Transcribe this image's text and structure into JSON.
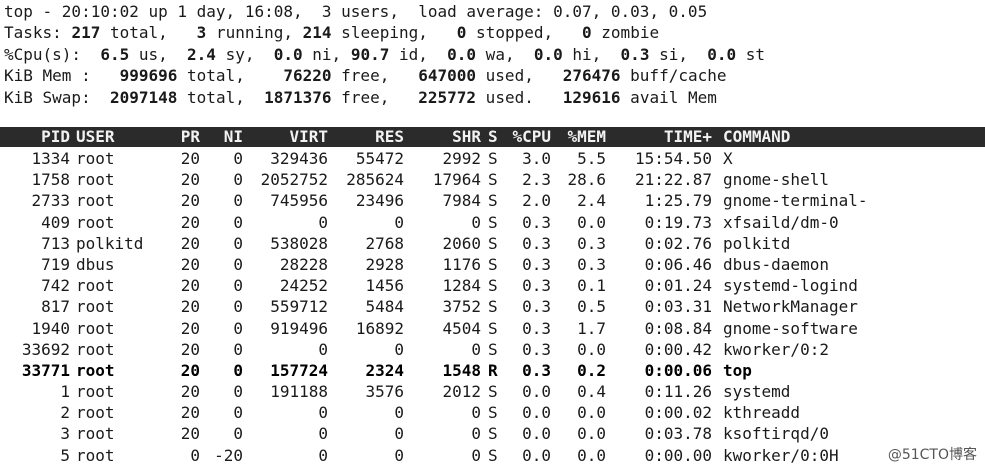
{
  "summary": {
    "line1": "top - 20:10:02 up 1 day, 16:08,  3 users,  load average: 0.07, 0.03, 0.05",
    "line2": {
      "p0": "Tasks: ",
      "total": "217",
      "p1": " total,   ",
      "running": "3",
      "p2": " running, ",
      "sleeping": "214",
      "p3": " sleeping,   ",
      "stopped": "0",
      "p4": " stopped,   ",
      "zombie": "0",
      "p5": " zombie"
    },
    "line3": {
      "p0": "%Cpu(s):  ",
      "us": "6.5",
      "p1": " us,  ",
      "sy": "2.4",
      "p2": " sy,  ",
      "ni": "0.0",
      "p3": " ni, ",
      "id": "90.7",
      "p4": " id,  ",
      "wa": "0.0",
      "p5": " wa,  ",
      "hi": "0.0",
      "p6": " hi,  ",
      "si": "0.3",
      "p7": " si,  ",
      "st": "0.0",
      "p8": " st"
    },
    "line4": {
      "p0": "KiB Mem :   ",
      "total": "999696",
      "p1": " total,    ",
      "free": "76220",
      "p2": " free,   ",
      "used": "647000",
      "p3": " used,   ",
      "buff": "276476",
      "p4": " buff/cache"
    },
    "line5": {
      "p0": "KiB Swap:  ",
      "total": "2097148",
      "p1": " total,  ",
      "free": "1871376",
      "p2": " free,   ",
      "used": "225772",
      "p3": " used.   ",
      "avail": "129616",
      "p4": " avail Mem"
    }
  },
  "columns": [
    "PID",
    "USER",
    "PR",
    "NI",
    "VIRT",
    "RES",
    "SHR",
    "S",
    "%CPU",
    "%MEM",
    "TIME+",
    "COMMAND"
  ],
  "processes": [
    {
      "pid": "1334",
      "user": "root",
      "pr": "20",
      "ni": "0",
      "virt": "329436",
      "res": "55472",
      "shr": "2992",
      "s": "S",
      "cpu": "3.0",
      "mem": "5.5",
      "time": "15:54.50",
      "cmd": "X"
    },
    {
      "pid": "1758",
      "user": "root",
      "pr": "20",
      "ni": "0",
      "virt": "2052752",
      "res": "285624",
      "shr": "17964",
      "s": "S",
      "cpu": "2.3",
      "mem": "28.6",
      "time": "21:22.87",
      "cmd": "gnome-shell"
    },
    {
      "pid": "2733",
      "user": "root",
      "pr": "20",
      "ni": "0",
      "virt": "745956",
      "res": "23496",
      "shr": "7984",
      "s": "S",
      "cpu": "2.0",
      "mem": "2.4",
      "time": "1:25.79",
      "cmd": "gnome-terminal-"
    },
    {
      "pid": "409",
      "user": "root",
      "pr": "20",
      "ni": "0",
      "virt": "0",
      "res": "0",
      "shr": "0",
      "s": "S",
      "cpu": "0.3",
      "mem": "0.0",
      "time": "0:19.73",
      "cmd": "xfsaild/dm-0"
    },
    {
      "pid": "713",
      "user": "polkitd",
      "pr": "20",
      "ni": "0",
      "virt": "538028",
      "res": "2768",
      "shr": "2060",
      "s": "S",
      "cpu": "0.3",
      "mem": "0.3",
      "time": "0:02.76",
      "cmd": "polkitd"
    },
    {
      "pid": "719",
      "user": "dbus",
      "pr": "20",
      "ni": "0",
      "virt": "28228",
      "res": "2928",
      "shr": "1176",
      "s": "S",
      "cpu": "0.3",
      "mem": "0.3",
      "time": "0:06.46",
      "cmd": "dbus-daemon"
    },
    {
      "pid": "742",
      "user": "root",
      "pr": "20",
      "ni": "0",
      "virt": "24252",
      "res": "1456",
      "shr": "1284",
      "s": "S",
      "cpu": "0.3",
      "mem": "0.1",
      "time": "0:01.24",
      "cmd": "systemd-logind"
    },
    {
      "pid": "817",
      "user": "root",
      "pr": "20",
      "ni": "0",
      "virt": "559712",
      "res": "5484",
      "shr": "3752",
      "s": "S",
      "cpu": "0.3",
      "mem": "0.5",
      "time": "0:03.31",
      "cmd": "NetworkManager"
    },
    {
      "pid": "1940",
      "user": "root",
      "pr": "20",
      "ni": "0",
      "virt": "919496",
      "res": "16892",
      "shr": "4504",
      "s": "S",
      "cpu": "0.3",
      "mem": "1.7",
      "time": "0:08.84",
      "cmd": "gnome-software"
    },
    {
      "pid": "33692",
      "user": "root",
      "pr": "20",
      "ni": "0",
      "virt": "0",
      "res": "0",
      "shr": "0",
      "s": "S",
      "cpu": "0.3",
      "mem": "0.0",
      "time": "0:00.42",
      "cmd": "kworker/0:2"
    },
    {
      "pid": "33771",
      "user": "root",
      "pr": "20",
      "ni": "0",
      "virt": "157724",
      "res": "2324",
      "shr": "1548",
      "s": "R",
      "cpu": "0.3",
      "mem": "0.2",
      "time": "0:00.06",
      "cmd": "top",
      "bold": true
    },
    {
      "pid": "1",
      "user": "root",
      "pr": "20",
      "ni": "0",
      "virt": "191188",
      "res": "3576",
      "shr": "2012",
      "s": "S",
      "cpu": "0.0",
      "mem": "0.4",
      "time": "0:11.26",
      "cmd": "systemd"
    },
    {
      "pid": "2",
      "user": "root",
      "pr": "20",
      "ni": "0",
      "virt": "0",
      "res": "0",
      "shr": "0",
      "s": "S",
      "cpu": "0.0",
      "mem": "0.0",
      "time": "0:00.02",
      "cmd": "kthreadd"
    },
    {
      "pid": "3",
      "user": "root",
      "pr": "20",
      "ni": "0",
      "virt": "0",
      "res": "0",
      "shr": "0",
      "s": "S",
      "cpu": "0.0",
      "mem": "0.0",
      "time": "0:03.78",
      "cmd": "ksoftirqd/0"
    },
    {
      "pid": "5",
      "user": "root",
      "pr": "0",
      "ni": "-20",
      "virt": "0",
      "res": "0",
      "shr": "0",
      "s": "S",
      "cpu": "0.0",
      "mem": "0.0",
      "time": "0:00.00",
      "cmd": "kworker/0:0H"
    }
  ],
  "watermark": "@51CTO博客",
  "colors": {
    "header_bg": "#2b2b2b",
    "header_fg": "#f2f2f2",
    "text": "#1a1a1a"
  }
}
